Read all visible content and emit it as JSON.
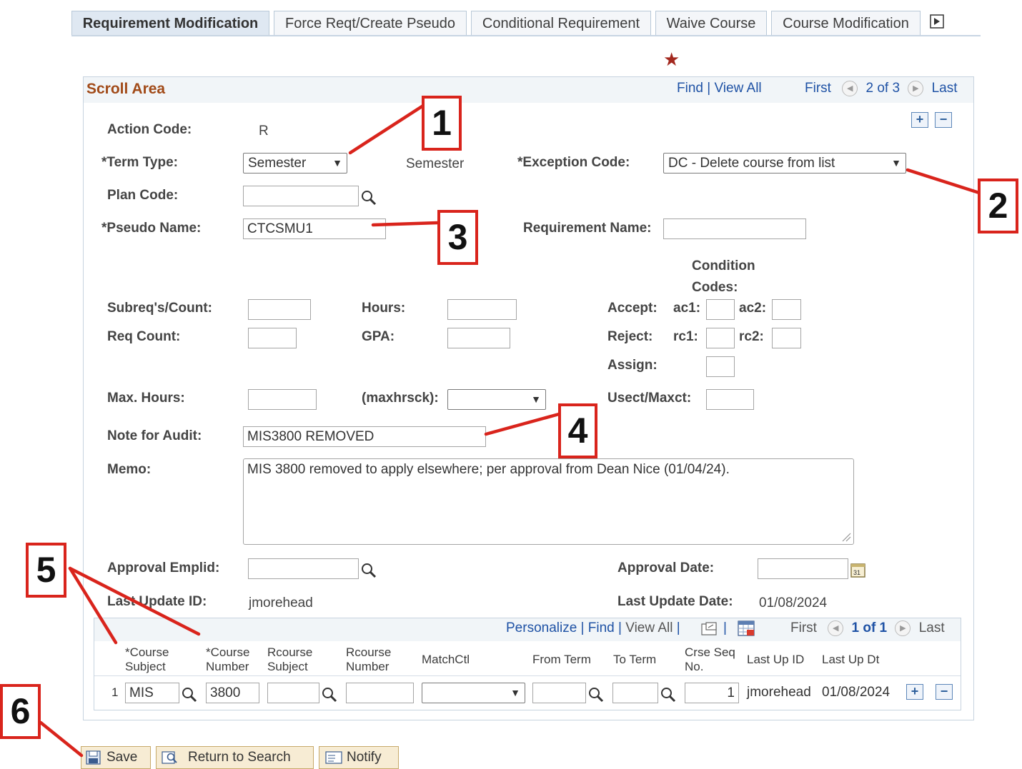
{
  "tabs": [
    "Requirement Modification",
    "Force Reqt/Create Pseudo",
    "Conditional Requirement",
    "Waive Course",
    "Course Modification"
  ],
  "scroll_area": {
    "title": "Scroll Area",
    "find": "Find",
    "view_all": "View All",
    "first": "First",
    "counter": "2 of 3",
    "last": "Last"
  },
  "form": {
    "action_code_label": "Action Code:",
    "action_code_value": "R",
    "term_type_label": "*Term Type:",
    "term_type_value": "Semester",
    "term_type_desc": "Semester",
    "exception_code_label": "*Exception Code:",
    "exception_code_value": "DC - Delete course from list",
    "plan_code_label": "Plan Code:",
    "pseudo_name_label": "*Pseudo Name:",
    "pseudo_name_value": "CTCSMU1",
    "requirement_name_label": "Requirement Name:",
    "condition_codes_line1": "Condition",
    "condition_codes_line2": "Codes:",
    "subreq_count_label": "Subreq's/Count:",
    "hours_label": "Hours:",
    "accept_label": "Accept:",
    "ac1_label": "ac1:",
    "ac2_label": "ac2:",
    "req_count_label": "Req Count:",
    "gpa_label": "GPA:",
    "reject_label": "Reject:",
    "rc1_label": "rc1:",
    "rc2_label": "rc2:",
    "assign_label": "Assign:",
    "max_hours_label": "Max. Hours:",
    "maxhrsck_label": "(maxhrsck):",
    "usect_label": "Usect/Maxct:",
    "note_label": "Note for Audit:",
    "note_value": "MIS3800 REMOVED",
    "memo_label": "Memo:",
    "memo_value": "MIS 3800 removed to apply elsewhere; per approval from Dean Nice (01/04/24).",
    "approval_emplid_label": "Approval Emplid:",
    "approval_date_label": "Approval Date:",
    "last_update_id_label": "Last Update ID:",
    "last_update_id_value": "jmorehead",
    "last_update_date_label": "Last Update Date:",
    "last_update_date_value": "01/08/2024"
  },
  "grid": {
    "personalize": "Personalize",
    "find": "Find",
    "view_all": "View All",
    "first": "First",
    "counter": "1 of 1",
    "last": "Last",
    "headers": {
      "course_subject_1": "*Course",
      "course_subject_2": "Subject",
      "course_number_1": "*Course",
      "course_number_2": "Number",
      "rcourse_subject_1": "Rcourse",
      "rcourse_subject_2": "Subject",
      "rcourse_number_1": "Rcourse",
      "rcourse_number_2": "Number",
      "matchctl": "MatchCtl",
      "from_term": "From Term",
      "to_term": "To Term",
      "crse_seq_1": "Crse Seq",
      "crse_seq_2": "No.",
      "last_up_id": "Last Up ID",
      "last_up_dt": "Last Up Dt"
    },
    "row": {
      "num": "1",
      "course_subject": "MIS",
      "course_number": "3800",
      "crse_seq": "1",
      "last_up_id": "jmorehead",
      "last_up_dt": "01/08/2024"
    }
  },
  "buttons": {
    "save": "Save",
    "return_to_search": "Return to Search",
    "notify": "Notify"
  },
  "annotations": [
    "1",
    "2",
    "3",
    "4",
    "5",
    "6"
  ],
  "colors": {
    "annotation_red": "#d9241c",
    "link_blue": "#1f52a5",
    "scroll_title": "#a14a18",
    "required_star": "#a3281e"
  }
}
